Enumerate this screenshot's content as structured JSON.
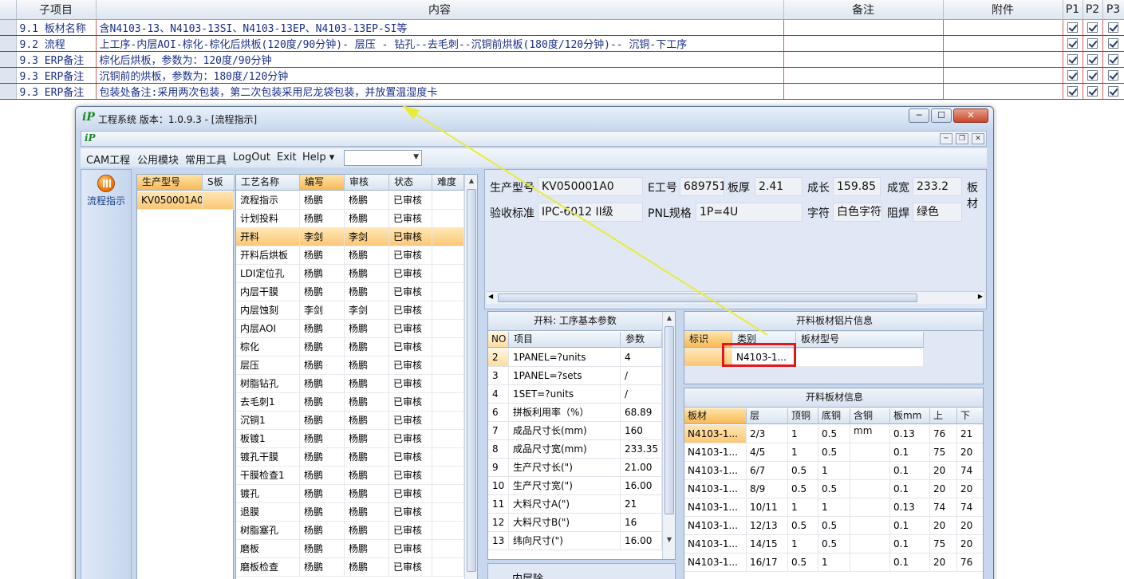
{
  "spec_table": {
    "headers": [
      "子项目",
      "内容",
      "备注",
      "附件",
      "P1",
      "P2",
      "P3"
    ],
    "rows": [
      {
        "item": "9.1 板材名称",
        "content": "含N4103-13、N4103-13SI、N4103-13EP、N4103-13EP-SI等",
        "note": "",
        "attach": ""
      },
      {
        "item": "9.2 流程",
        "content": "上工序-内层AOI-棕化-棕化后烘板(120度/90分钟)- 层压 - 钻孔--去毛刺--沉铜前烘板(180度/120分钟)-- 沉铜-下工序",
        "note": "",
        "attach": ""
      },
      {
        "item": "9.3 ERP备注",
        "content": "棕化后烘板，参数为：120度/90分钟",
        "note": "",
        "attach": ""
      },
      {
        "item": "9.3 ERP备注",
        "content": "沉铜前的烘板，参数为：180度/120分钟",
        "note": "",
        "attach": ""
      },
      {
        "item": "9.3 ERP备注",
        "content": "包装处备注:采用两次包装，第二次包装采用尼龙袋包装，并放置温湿度卡",
        "note": "",
        "attach": ""
      }
    ]
  },
  "window": {
    "title": "工程系统  版本：1.0.9.3 - [流程指示]",
    "logo_text": "iP",
    "min_label": "─",
    "max_label": "☐",
    "close_label": "✕"
  },
  "menu": {
    "items": [
      "CAM工程",
      "公用模块",
      "常用工具",
      "LogOut",
      "Exit",
      "Help ▾"
    ],
    "combo_value": ""
  },
  "toolbar": {
    "flow_button_label": "流程指示"
  },
  "product_list": {
    "headers": [
      "生产型号",
      "S板"
    ],
    "rows": [
      "KV050001A0"
    ]
  },
  "process_list": {
    "headers": [
      "工艺名称",
      "编写",
      "审核",
      "状态",
      "难度"
    ],
    "selected_index": 2,
    "rows": [
      [
        "流程指示",
        "杨鹏",
        "杨鹏",
        "已审核"
      ],
      [
        "计划投料",
        "杨鹏",
        "杨鹏",
        "已审核"
      ],
      [
        "开料",
        "李剑",
        "李剑",
        "已审核"
      ],
      [
        "开料后烘板",
        "杨鹏",
        "杨鹏",
        "已审核"
      ],
      [
        "LDI定位孔",
        "杨鹏",
        "杨鹏",
        "已审核"
      ],
      [
        "内层干膜",
        "杨鹏",
        "杨鹏",
        "已审核"
      ],
      [
        "内层蚀刻",
        "李剑",
        "李剑",
        "已审核"
      ],
      [
        "内层AOI",
        "杨鹏",
        "杨鹏",
        "已审核"
      ],
      [
        "棕化",
        "杨鹏",
        "杨鹏",
        "已审核"
      ],
      [
        "层压",
        "杨鹏",
        "杨鹏",
        "已审核"
      ],
      [
        "树脂钻孔",
        "杨鹏",
        "杨鹏",
        "已审核"
      ],
      [
        "去毛刺1",
        "杨鹏",
        "杨鹏",
        "已审核"
      ],
      [
        "沉铜1",
        "杨鹏",
        "杨鹏",
        "已审核"
      ],
      [
        "板镀1",
        "杨鹏",
        "杨鹏",
        "已审核"
      ],
      [
        "镀孔干膜",
        "杨鹏",
        "杨鹏",
        "已审核"
      ],
      [
        "干膜检查1",
        "杨鹏",
        "杨鹏",
        "已审核"
      ],
      [
        "镀孔",
        "杨鹏",
        "杨鹏",
        "已审核"
      ],
      [
        "退膜",
        "杨鹏",
        "杨鹏",
        "已审核"
      ],
      [
        "树脂塞孔",
        "杨鹏",
        "杨鹏",
        "已审核"
      ],
      [
        "磨板",
        "杨鹏",
        "杨鹏",
        "已审核"
      ],
      [
        "磨板检查",
        "杨鹏",
        "杨鹏",
        "已审核"
      ]
    ]
  },
  "info": {
    "fields": [
      {
        "label": "生产型号",
        "value": "KV050001A0"
      },
      {
        "label": "E工号",
        "value": "689751"
      },
      {
        "label": "板厚",
        "value": "2.41"
      },
      {
        "label": "成长",
        "value": "159.85"
      },
      {
        "label": "成宽",
        "value": "233.2"
      },
      {
        "label": "板材",
        "value": ""
      },
      {
        "label": "验收标准",
        "value": "IPC-6012 II级"
      },
      {
        "label": "PNL规格",
        "value": "1P=4U"
      },
      {
        "label": "字符",
        "value": "白色字符"
      },
      {
        "label": "阻焊",
        "value": "绿色"
      }
    ]
  },
  "params": {
    "title": "开料: 工序基本参数",
    "headers": [
      "NO",
      "项目",
      "参数"
    ],
    "rows": [
      [
        "2",
        "1PANEL=?units",
        "4"
      ],
      [
        "3",
        "1PANEL=?sets",
        "/"
      ],
      [
        "4",
        "1SET=?units",
        "/"
      ],
      [
        "6",
        "拼板利用率（%）",
        "68.89"
      ],
      [
        "7",
        "成品尺寸长(mm)",
        "160"
      ],
      [
        "8",
        "成品尺寸宽(mm)",
        "233.35"
      ],
      [
        "9",
        "生产尺寸长(\")",
        "21.00"
      ],
      [
        "10",
        "生产尺寸宽(\")",
        "16.00"
      ],
      [
        "11",
        "大料尺寸A(\")",
        "21"
      ],
      [
        "12",
        "大料尺寸B(\")",
        "16"
      ],
      [
        "13",
        "纬向尺寸(\")",
        "16.00"
      ]
    ]
  },
  "sheet_info": {
    "title": "开料板材铝片信息",
    "headers": [
      "标识",
      "类别",
      "板材型号"
    ],
    "rows": [
      [
        "",
        "N4103-1...",
        ""
      ]
    ]
  },
  "material_info": {
    "title": "开料板材信息",
    "headers": [
      "板材",
      "层",
      "顶铜",
      "底铜",
      "含铜mm",
      "板mm",
      "上",
      "下"
    ],
    "rows": [
      [
        "N4103-1...",
        "2/3",
        "1",
        "0.5",
        "",
        "0.13",
        "76",
        "21"
      ],
      [
        "N4103-1...",
        "4/5",
        "1",
        "0.5",
        "",
        "0.1",
        "75",
        "20"
      ],
      [
        "N4103-1...",
        "6/7",
        "0.5",
        "1",
        "",
        "0.1",
        "20",
        "74"
      ],
      [
        "N4103-1...",
        "8/9",
        "0.5",
        "0.5",
        "",
        "0.1",
        "20",
        "20"
      ],
      [
        "N4103-1...",
        "10/11",
        "1",
        "1",
        "",
        "0.13",
        "74",
        "74"
      ],
      [
        "N4103-1...",
        "12/13",
        "0.5",
        "0.5",
        "",
        "0.1",
        "20",
        "20"
      ],
      [
        "N4103-1...",
        "14/15",
        "1",
        "0.5",
        "",
        "0.1",
        "75",
        "20"
      ],
      [
        "N4103-1...",
        "16/17",
        "0.5",
        "1",
        "",
        "0.1",
        "20",
        "76"
      ]
    ]
  },
  "bottom_strip": {
    "label": "内层除"
  },
  "colors": {
    "highlight": "#f8b956",
    "annotation_red": "#e0181b",
    "arrow_yellow": "#e8ec3a",
    "row_border_red": "#d02020"
  }
}
